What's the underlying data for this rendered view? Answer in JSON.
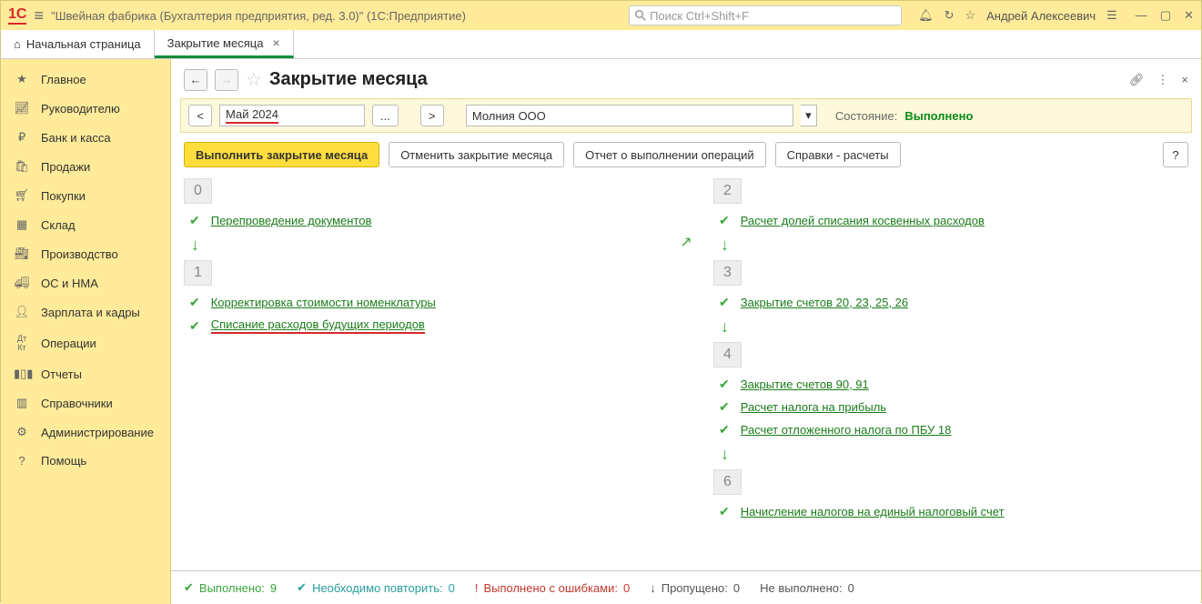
{
  "titlebar": {
    "app_title": "\"Швейная фабрика (Бухгалтерия предприятия, ред. 3.0)\"  (1С:Предприятие)",
    "search_placeholder": "Поиск Ctrl+Shift+F",
    "user": "Андрей Алексеевич"
  },
  "tabs": {
    "home": "Начальная страница",
    "active": "Закрытие месяца"
  },
  "sidebar": {
    "items": [
      {
        "label": "Главное"
      },
      {
        "label": "Руководителю"
      },
      {
        "label": "Банк и касса"
      },
      {
        "label": "Продажи"
      },
      {
        "label": "Покупки"
      },
      {
        "label": "Склад"
      },
      {
        "label": "Производство"
      },
      {
        "label": "ОС и НМА"
      },
      {
        "label": "Зарплата и кадры"
      },
      {
        "label": "Операции"
      },
      {
        "label": "Отчеты"
      },
      {
        "label": "Справочники"
      },
      {
        "label": "Администрирование"
      },
      {
        "label": "Помощь"
      }
    ]
  },
  "page": {
    "title": "Закрытие месяца",
    "period": "Май 2024",
    "period_ellipsis": "...",
    "org": "Молния ООО",
    "state_label": "Состояние:",
    "state_value": "Выполнено"
  },
  "toolbar": {
    "execute": "Выполнить закрытие месяца",
    "cancel": "Отменить закрытие месяца",
    "report": "Отчет о выполнении операций",
    "refs": "Справки - расчеты",
    "help": "?"
  },
  "stages": {
    "left": [
      {
        "num": "0",
        "ops": [
          {
            "label": "Перепроведение документов"
          }
        ]
      },
      {
        "num": "1",
        "ops": [
          {
            "label": "Корректировка стоимости номенклатуры"
          },
          {
            "label": "Списание расходов будущих периодов",
            "red": true
          }
        ]
      }
    ],
    "right": [
      {
        "num": "2",
        "ops": [
          {
            "label": "Расчет долей списания косвенных расходов"
          }
        ]
      },
      {
        "num": "3",
        "ops": [
          {
            "label": "Закрытие счетов 20, 23, 25, 26"
          }
        ]
      },
      {
        "num": "4",
        "ops": [
          {
            "label": "Закрытие счетов 90, 91"
          },
          {
            "label": "Расчет налога на прибыль"
          },
          {
            "label": "Расчет отложенного налога по ПБУ 18"
          }
        ]
      },
      {
        "num": "6",
        "ops": [
          {
            "label": "Начисление налогов на единый налоговый счет"
          }
        ]
      }
    ]
  },
  "status": {
    "done_label": "Выполнено:",
    "done_val": "9",
    "repeat_label": "Необходимо повторить:",
    "repeat_val": "0",
    "err_label": "Выполнено с ошибками:",
    "err_val": "0",
    "skip_label": "Пропущено:",
    "skip_val": "0",
    "notdone_label": "Не выполнено:",
    "notdone_val": "0"
  }
}
